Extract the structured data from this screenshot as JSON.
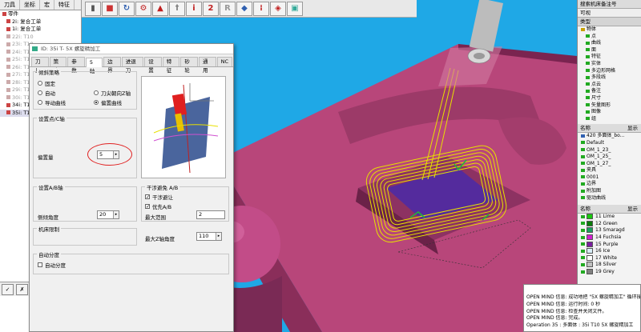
{
  "left_panel": {
    "tabs": [
      "刀具",
      "坐标",
      "宏",
      "特征"
    ],
    "tree": [
      {
        "text": "零件",
        "cls": ""
      },
      {
        "text": "2i: 复合工单",
        "cls": "sub"
      },
      {
        "text": "1i: 复合工单",
        "cls": "sub"
      },
      {
        "text": "22i: T10",
        "cls": "sub dim"
      },
      {
        "text": "23i: T10",
        "cls": "sub dim"
      },
      {
        "text": "24i: T10",
        "cls": "sub dim"
      },
      {
        "text": "25i: T10",
        "cls": "sub dim"
      },
      {
        "text": "26i: T10",
        "cls": "sub dim"
      },
      {
        "text": "27i: T10",
        "cls": "sub dim"
      },
      {
        "text": "28i: T10",
        "cls": "sub dim"
      },
      {
        "text": "29i: T10",
        "cls": "sub dim"
      },
      {
        "text": "30i: T10",
        "cls": "sub dim"
      },
      {
        "text": "34i: T10 5X",
        "cls": "sub"
      },
      {
        "text": "35i: T10 5X",
        "cls": "sub sel"
      }
    ],
    "bottom_buttons": [
      "✓",
      "✗",
      "◧",
      "▦"
    ]
  },
  "toolbar": {
    "icons": [
      "▮",
      "■",
      "↻",
      "⚙",
      "▲",
      "ꝉ",
      "i",
      "2",
      "R",
      "◆",
      "⁞",
      "◈",
      "▣"
    ]
  },
  "dialog": {
    "title": "ID: 35i T- 5X 螺旋精加工",
    "tabs": [
      "刀具",
      "策略",
      "参数",
      "5 轴",
      "边界",
      "进退刀",
      "设置",
      "特征",
      "砂轮",
      "通用",
      "NC"
    ],
    "active_tab": "5 轴",
    "group_tilt_strategy": "倾斜策略",
    "radios_left": [
      "固定",
      "自动",
      "导动曲线"
    ],
    "radios_right": [
      "刀尖朝向Z轴",
      "偏置曲线"
    ],
    "selected_radio": "偏置曲线",
    "group_cd": "设置点/C轴",
    "lead_label": "偏置量",
    "lead_value": "5",
    "group_ab": "设置A/B轴",
    "tilt_label": "侧倾角度",
    "tilt_value": "20",
    "group_limit": "机床限制",
    "group_interference": "干涉避免 A/B",
    "chk_interference": "干涉避让",
    "chk_priority": "优先A/B",
    "max_range_label": "最大范围",
    "max_range_value": "2",
    "max_angle_label": "最大Z轴角度",
    "max_angle_value": "110",
    "group_auto": "自动分度",
    "chk_auto": "自动分度"
  },
  "right_panel": {
    "top_title": "搜索机床备注号",
    "section1": "可视",
    "section1_col": "类型",
    "objects": [
      "物体",
      "点",
      "曲线",
      "面",
      "特征",
      "实体",
      "多边形网格",
      "多段线",
      "点云",
      "备注",
      "尺寸",
      "矢量图形",
      "图像",
      "组"
    ],
    "section2_cols": [
      "名称",
      "显示"
    ],
    "layers": [
      "420 多面体_bo...",
      "Default",
      "OM_1_23_",
      "OM_1_25_",
      "OM_1_27_",
      "夹具",
      "0001",
      "边界",
      "附加图",
      "驱动曲线"
    ],
    "section3_cols": [
      "名称",
      "显示"
    ],
    "colors": [
      {
        "name": "11 Lime",
        "hex": "#19c80f"
      },
      {
        "name": "12 Green",
        "hex": "#0b7d0b"
      },
      {
        "name": "13 Smaragd",
        "hex": "#1aa060"
      },
      {
        "name": "14 Fuchsia",
        "hex": "#d21ed2"
      },
      {
        "name": "15 Purple",
        "hex": "#7a1ea0"
      },
      {
        "name": "16 Ice",
        "hex": "#d8eef8"
      },
      {
        "name": "17 White",
        "hex": "#ffffff"
      },
      {
        "name": "18 Silver",
        "hex": "#c0c0c0"
      },
      {
        "name": "19 Grey",
        "hex": "#808080"
      }
    ]
  },
  "log": {
    "lines": [
      "OPEN MIND 信息:   成功地把 \"5X 螺旋精加工\" 循环操作",
      "OPEN MIND 信息:   运行时间: 0 秒",
      "OPEN MIND 信息:   检查并关闭文件。",
      "OPEN MIND 信息:   完成。",
      "Operation 35 : 多面体 : 35i T10 5X 螺旋精加工"
    ]
  }
}
